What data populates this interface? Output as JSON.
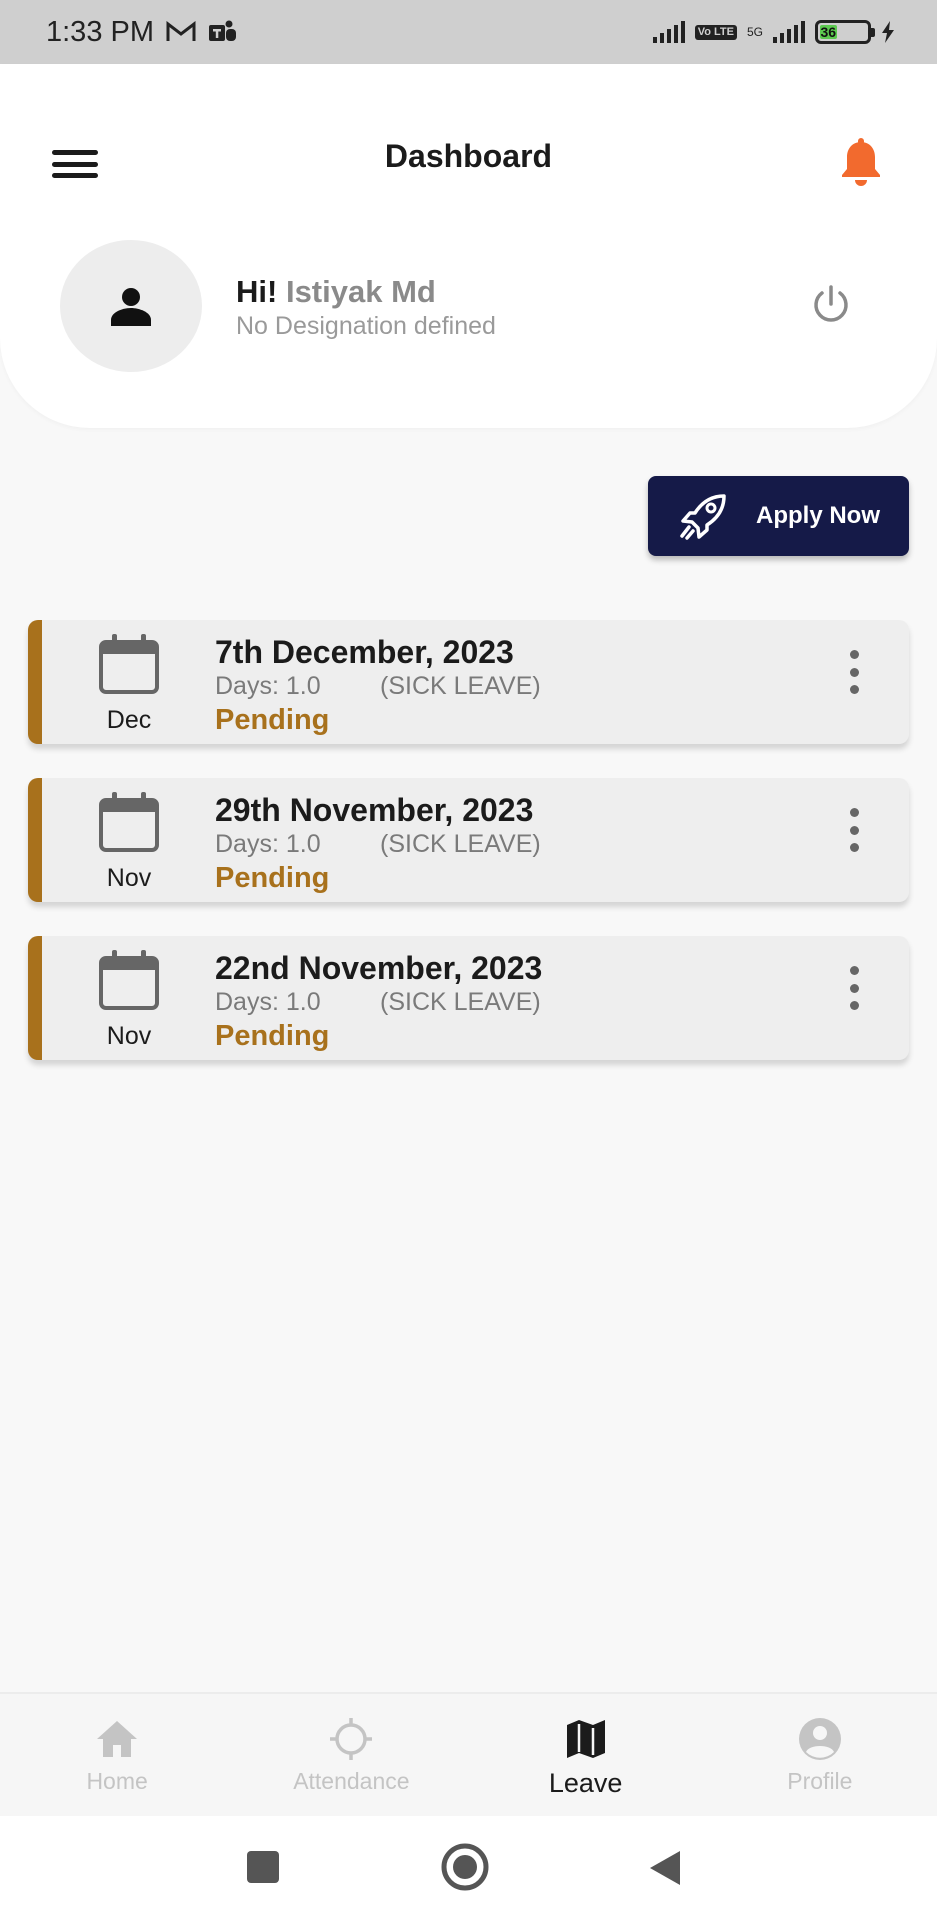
{
  "status_bar": {
    "time": "1:33 PM",
    "battery": "36",
    "network": "5G",
    "volte": "Vo LTE"
  },
  "header": {
    "title": "Dashboard",
    "greeting_prefix": "Hi!",
    "user_name": "Istiyak Md",
    "designation": "No Designation defined"
  },
  "actions": {
    "apply_label": "Apply Now"
  },
  "leaves": [
    {
      "month": "Dec",
      "date": "7th December, 2023",
      "days": "Days: 1.0",
      "type": "(SICK LEAVE)",
      "status": "Pending"
    },
    {
      "month": "Nov",
      "date": "29th November, 2023",
      "days": "Days: 1.0",
      "type": "(SICK LEAVE)",
      "status": "Pending"
    },
    {
      "month": "Nov",
      "date": "22nd November, 2023",
      "days": "Days: 1.0",
      "type": "(SICK LEAVE)",
      "status": "Pending"
    }
  ],
  "bottom_nav": {
    "items": [
      {
        "label": "Home",
        "icon": "home-icon",
        "active": false
      },
      {
        "label": "Attendance",
        "icon": "crosshair-icon",
        "active": false
      },
      {
        "label": "Leave",
        "icon": "map-icon",
        "active": true
      },
      {
        "label": "Profile",
        "icon": "account-circle-icon",
        "active": false
      }
    ]
  },
  "colors": {
    "accent": "#a8711c",
    "button_bg": "#151a48",
    "bell": "#f26a2e",
    "status_pending": "#a8711c"
  }
}
